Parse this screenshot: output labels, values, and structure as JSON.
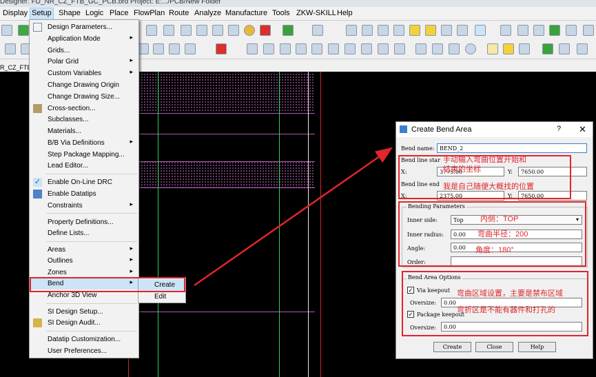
{
  "title_bar": {
    "text": "Designer: FD_NR_CZ_FTB_GC_PCB.brd  Project: E:.../PCB/New Folder"
  },
  "menubar": {
    "items": [
      "Display",
      "Setup",
      "Shape",
      "Logic",
      "Place",
      "FlowPlan",
      "Route",
      "Analyze",
      "Manufacture",
      "Tools",
      "ZKW-SKILL",
      "Help"
    ]
  },
  "status": {
    "design_name": "R_CZ_FTB_GC_PCB"
  },
  "setup_menu": {
    "items": [
      "Design Parameters...",
      "Application Mode",
      "Grids...",
      "Polar Grid",
      "Custom Variables",
      "Change Drawing Origin",
      "Change Drawing Size...",
      "Cross-section...",
      "Subclasses...",
      "Materials...",
      "B/B Via Definitions",
      "Step Package Mapping...",
      "Lead Editor...",
      "Enable On-Line DRC",
      "Enable Datatips",
      "Constraints",
      "Property Definitions...",
      "Define Lists...",
      "Areas",
      "Outlines",
      "Zones",
      "Bend",
      "Anchor 3D View",
      "SI Design Setup...",
      "SI Design Audit...",
      "Datatip Customization...",
      "User Preferences..."
    ]
  },
  "bend_submenu": {
    "items": [
      "Create",
      "Edit"
    ]
  },
  "dialog": {
    "title": "Create Bend Area",
    "help_glyph": "?",
    "close_glyph": "✕",
    "bend_name_label": "Bend name:",
    "bend_name_value": "BEND_2",
    "line_start_label": "Bend line star",
    "start_x_label": "X:",
    "start_x_value": "3775.00",
    "start_y_label": "Y:",
    "start_y_value": "7650.00",
    "line_end_label": "Bend line end",
    "end_x_label": "X:",
    "end_x_value": "2375.00",
    "end_y_label": "Y:",
    "end_y_value": "7650.00",
    "bending_params_label": "Bending Parameters",
    "inner_side_label": "Inner side:",
    "inner_side_value": "Top",
    "inner_radius_label": "Inner radius:",
    "inner_radius_value": "0.00",
    "angle_label": "Angle:",
    "angle_value": "0.00",
    "order_label": "Order:",
    "order_value": "",
    "area_options_label": "Bend Area Options",
    "via_keepout_label": "Via keepout",
    "via_oversize_label": "Oversize:",
    "via_oversize_value": "0.00",
    "package_keepout_label": "Package keepout",
    "pkg_oversize_label": "Oversize:",
    "pkg_oversize_value": "0.00",
    "create_button": "Create",
    "close_button": "Close",
    "help_button": "Help"
  },
  "annotations": {
    "note_start_1": "手动输入弯曲位置开始和",
    "note_start_2": "结束的坐标",
    "note_position": "我是自己随便大概找的位置",
    "note_inner_side": "内侧：TOP",
    "note_radius": "弯曲半径：200",
    "note_angle": "角度：180°",
    "note_area_1": "弯曲区域设置，主要是禁布区域",
    "note_area_2": "弯折区是不能有器件和打孔的"
  },
  "colors": {
    "annotation_red": "#e0262b",
    "menu_highlight": "#cce4f7",
    "canvas_bg": "#000000",
    "grid_line_green": "#2fcf5f",
    "outline_magenta": "#b05fb0"
  }
}
